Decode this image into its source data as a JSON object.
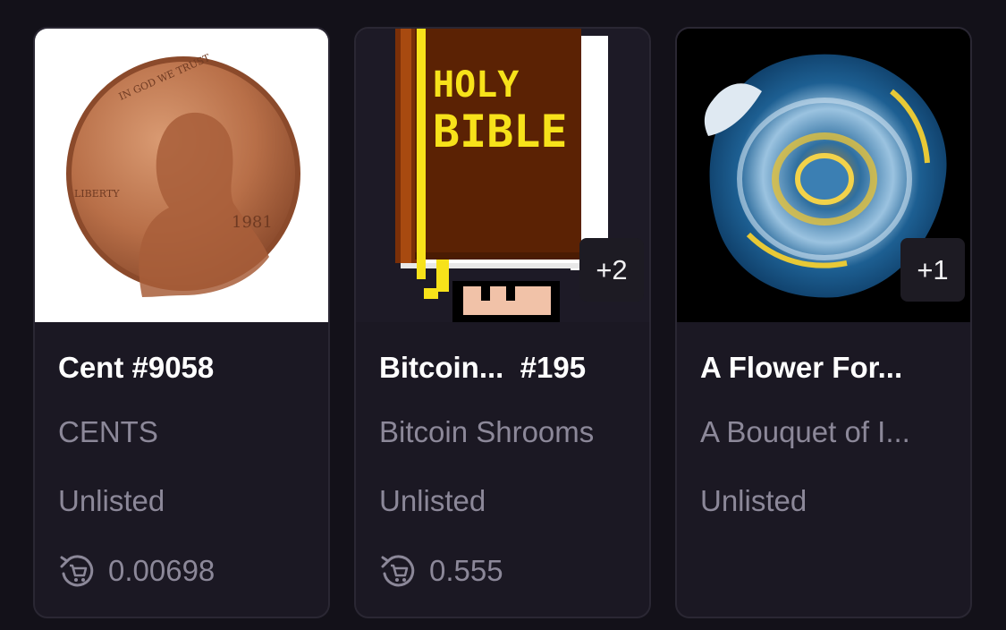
{
  "cards": [
    {
      "title": "Cent #9058",
      "collection": "CENTS",
      "status": "Unlisted",
      "price": "0.00698",
      "image": {
        "icon": "penny-coin-image",
        "coin_text": [
          "IN GOD WE TRUST",
          "LIBERTY",
          "1981"
        ]
      },
      "badge": null
    },
    {
      "title": "Bitcoin...  #195",
      "collection": "Bitcoin Shrooms",
      "status": "Unlisted",
      "price": "0.555",
      "image": {
        "icon": "pixel-holy-bible-image",
        "cover_text": [
          "HOLY",
          "BIBLE"
        ]
      },
      "badge": "+2"
    },
    {
      "title": "A Flower For...",
      "collection": "A Bouquet of I...",
      "status": "Unlisted",
      "image": {
        "icon": "blue-rose-image"
      },
      "badge": "+1"
    }
  ],
  "colors": {
    "background": "#131119",
    "card": "#1b1823",
    "muted_text": "#8c8899",
    "title_text": "#ffffff"
  },
  "icons": {
    "price": "cart-refresh-icon"
  }
}
